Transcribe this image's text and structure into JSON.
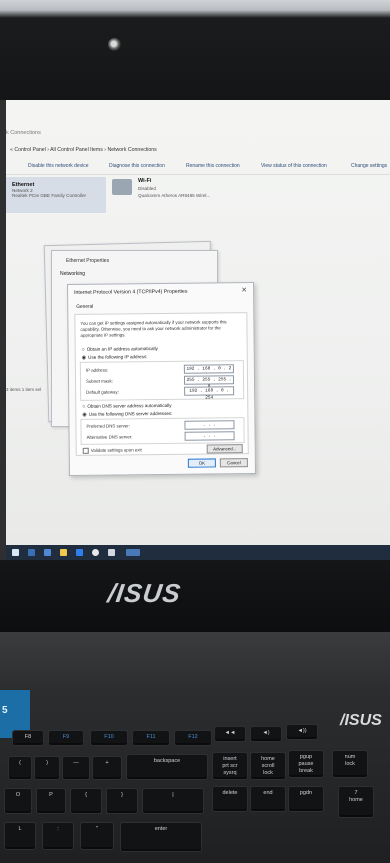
{
  "explorer": {
    "window_title": "k Connections",
    "address": "« Control Panel › All Control Panel Items › Network Connections",
    "toolbar": [
      "Disable this network device",
      "Diagnose this connection",
      "Rename this connection",
      "View status of this connection",
      "Change settings"
    ],
    "adapters": [
      {
        "name": "Ethernet",
        "line2": "Network 2",
        "line3": "Realtek PCIe GBE Family Controller"
      },
      {
        "name": "Wi-Fi",
        "line2": "Disabled",
        "line3": "Qualcomm Atheros AR9485 Wirel..."
      }
    ],
    "status": "3 items   1 item sel"
  },
  "ethernet_dialog": {
    "title": "Ethernet Properties",
    "tab": "Networking"
  },
  "ipv4_dialog": {
    "title": "Internet Protocol Version 4 (TCP/IPv4) Properties",
    "close": "✕",
    "tab": "General",
    "description": "You can get IP settings assigned automatically if your network supports this capability. Otherwise, you need to ask your network administrator for the appropriate IP settings.",
    "radio_auto_ip": "Obtain an IP address automatically",
    "radio_manual_ip": "Use the following IP address:",
    "ip_label": "IP address:",
    "ip_value": "192 . 168 . 0 . 2",
    "mask_label": "Subnet mask:",
    "mask_value": "255 . 255 . 255 . 0",
    "gateway_label": "Default gateway:",
    "gateway_value": "192 . 168 . 0 . 254",
    "radio_auto_dns": "Obtain DNS server address automatically",
    "radio_manual_dns": "Use the following DNS server addresses:",
    "dns1_label": "Preferred DNS server:",
    "dns2_label": "Alternative DNS server:",
    "dns_placeholder": ". . .",
    "validate": "Validate settings upon exit",
    "advanced": "Advanced...",
    "ok": "OK",
    "cancel": "Cancel"
  },
  "monitor": {
    "brand": "/ISUS"
  },
  "keyboard": {
    "brand": "/ISUS",
    "box_text": "5",
    "fkeys": [
      "F8",
      "F9",
      "F10",
      "F11",
      "F12",
      "◄◄",
      "◄)",
      "◄))"
    ],
    "row1": [
      "(",
      ")",
      "—",
      "+",
      "backspace",
      "insert\nprt scr\nsysrq",
      "home\nscroll\nlock",
      "pgup\npause\nbreak",
      "num\nlock"
    ],
    "row2": [
      "O",
      "P",
      "{",
      "}",
      "|",
      "delete",
      "end",
      "pgdn",
      "7\nhome"
    ],
    "row3": [
      "L",
      ":",
      "\"",
      "enter"
    ]
  },
  "colors": {
    "taskbar": "#1f2d3f",
    "accent": "#2b7ad6",
    "keyboard_box": "#1b6ea6"
  }
}
